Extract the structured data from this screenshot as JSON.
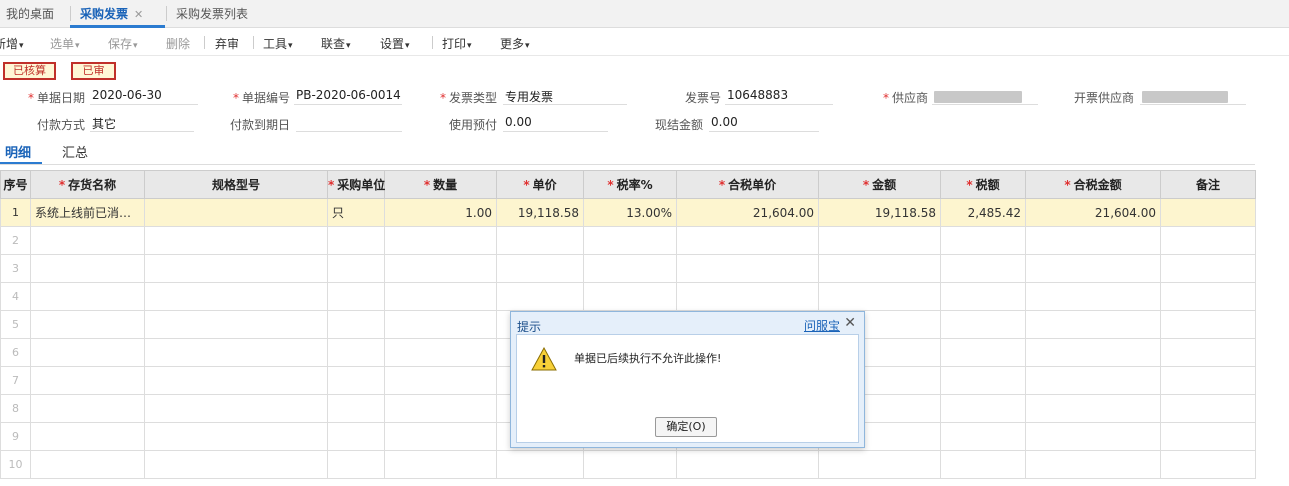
{
  "tabs": [
    {
      "label": "我的桌面"
    },
    {
      "label": "采购发票",
      "close": "✕"
    },
    {
      "label": "采购发票列表"
    }
  ],
  "toolbar": {
    "items": [
      {
        "label": "新增",
        "caret": "▾"
      },
      {
        "label": "选单",
        "caret": "▾"
      },
      {
        "label": "保存",
        "caret": "▾"
      },
      {
        "label": "删除"
      },
      {
        "label": "弃审"
      },
      {
        "label": "工具",
        "caret": "▾"
      },
      {
        "label": "联查",
        "caret": "▾"
      },
      {
        "label": "设置",
        "caret": "▾"
      },
      {
        "label": "打印",
        "caret": "▾"
      },
      {
        "label": "更多",
        "caret": "▾"
      }
    ]
  },
  "status": {
    "verified": "已核算",
    "audited": "已审"
  },
  "form": {
    "date_label": "单据日期",
    "date_value": "2020-06-30",
    "docno_label": "单据编号",
    "docno_value": "PB-2020-06-0014",
    "invtype_label": "发票类型",
    "invtype_value": "专用发票",
    "invno_label": "发票号",
    "invno_value": "10648883",
    "supplier_label": "供应商",
    "issuer_label": "开票供应商",
    "paymethod_label": "付款方式",
    "paymethod_value": "其它",
    "duedate_label": "付款到期日",
    "duedate_value": "",
    "prepay_label": "使用预付",
    "prepay_value": "0.00",
    "cash_label": "现结金额",
    "cash_value": "0.00",
    "required_mark": "*"
  },
  "subtabs": {
    "detail": "明细",
    "summary": "汇总"
  },
  "grid": {
    "headers": [
      "序号",
      "存货名称",
      "规格型号",
      "采购单位",
      "数量",
      "单价",
      "税率%",
      "合税单价",
      "金额",
      "税额",
      "合税金额",
      "备注"
    ],
    "required_cols": [
      false,
      true,
      false,
      true,
      true,
      true,
      true,
      true,
      true,
      true,
      true,
      false
    ],
    "row1": {
      "idx": "1",
      "name": "系统上线前已消…",
      "spec": "",
      "unit": "只",
      "qty": "1.00",
      "price": "19,118.58",
      "rate": "13.00%",
      "taxprice": "21,604.00",
      "amount": "19,118.58",
      "tax": "2,485.42",
      "total": "21,604.00",
      "note": ""
    },
    "empty_rows": [
      "2",
      "3",
      "4",
      "5",
      "6",
      "7",
      "8",
      "9",
      "10"
    ]
  },
  "dialog": {
    "title": "提示",
    "help": "问服宝",
    "close": "✕",
    "message": "单据已后续执行不允许此操作!",
    "ok_button": "确定(O)"
  }
}
